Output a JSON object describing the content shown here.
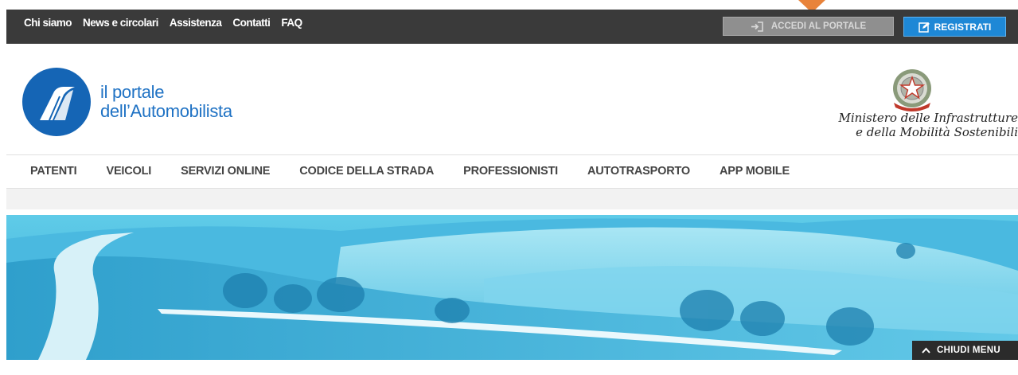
{
  "topnav": {
    "links": [
      "Chi siamo",
      "News e circolari",
      "Assistenza",
      "Contatti",
      "FAQ"
    ],
    "accedi_label": "ACCEDI AL PORTALE",
    "registrati_label": "REGISTRATI"
  },
  "header": {
    "logo_line1": "il portale",
    "logo_line2": "dell’Automobilista",
    "ministry_line1": "Ministero delle Infrastrutture",
    "ministry_line2": "e della Mobilità Sostenibili"
  },
  "mainnav": {
    "items": [
      "PATENTI",
      "VEICOLI",
      "SERVIZI ONLINE",
      "CODICE DELLA STRADA",
      "PROFESSIONISTI",
      "AUTOTRASPORTO",
      "APP MOBILE"
    ]
  },
  "hero": {
    "chiudi_label": "CHIUDI MENU"
  },
  "colors": {
    "topbar": "#3a3a3a",
    "brand_blue": "#1565b5",
    "registrati": "#1e88d6",
    "hero_tint": "#3fc0e6",
    "marker": "#e8833a"
  }
}
